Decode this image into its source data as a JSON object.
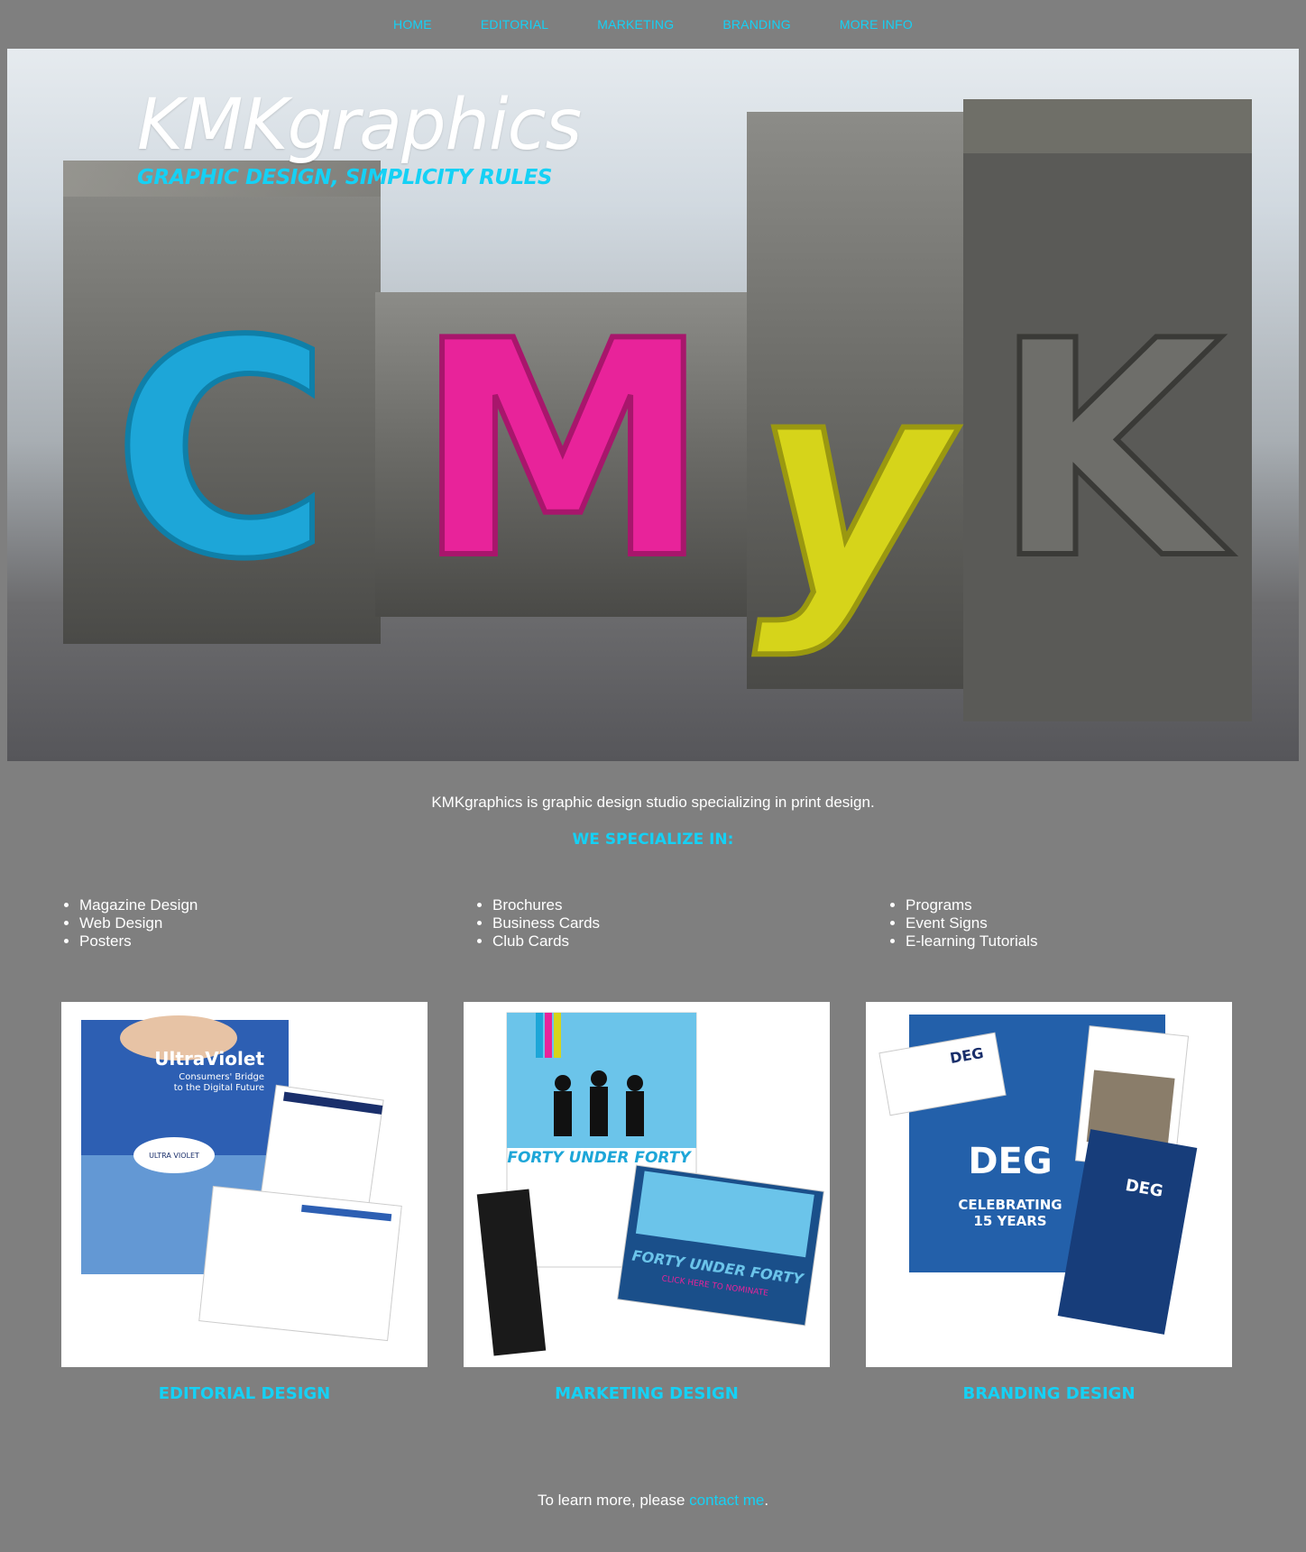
{
  "nav": {
    "items": [
      {
        "label": "HOME"
      },
      {
        "label": "EDITORIAL"
      },
      {
        "label": "MARKETING"
      },
      {
        "label": "BRANDING"
      },
      {
        "label": "MORE INFO"
      }
    ]
  },
  "hero": {
    "title": "KMKgraphics",
    "tagline": "GRAPHIC DESIGN, SIMPLICITY RULES",
    "letters": [
      "C",
      "M",
      "y",
      "K"
    ]
  },
  "intro": {
    "text": "KMKgraphics is graphic design studio specializing in print design.",
    "heading": "WE SPECIALIZE IN:"
  },
  "services": {
    "col1": [
      "Magazine Design",
      "Web Design",
      "Posters"
    ],
    "col2": [
      "Brochures",
      "Business Cards",
      "Club Cards"
    ],
    "col3": [
      "Programs",
      "Event Signs",
      "E-learning Tutorials"
    ]
  },
  "portfolio": {
    "items": [
      {
        "label": "EDITORIAL DESIGN"
      },
      {
        "label": "MARKETING DESIGN"
      },
      {
        "label": "BRANDING DESIGN"
      }
    ],
    "editorial_art": {
      "title": "UltraViolet",
      "subtitle1": "Consumers' Bridge",
      "subtitle2": "to the Digital Future",
      "badge": "ULTRA VIOLET"
    },
    "marketing_art": {
      "headline": "FORTY UNDER FORTY",
      "cta": "CLICK HERE TO NOMINATE"
    },
    "branding_art": {
      "logo": "DEG",
      "line1": "CELEBRATING",
      "line2": "15 YEARS"
    }
  },
  "footer": {
    "prefix": "To learn more, please ",
    "link": "contact me",
    "suffix": "."
  },
  "colors": {
    "background": "#7f7f7f",
    "accent": "#15d1f5",
    "cyan": "#1da6d8",
    "magenta": "#e8239a",
    "yellow": "#d6d41a"
  }
}
